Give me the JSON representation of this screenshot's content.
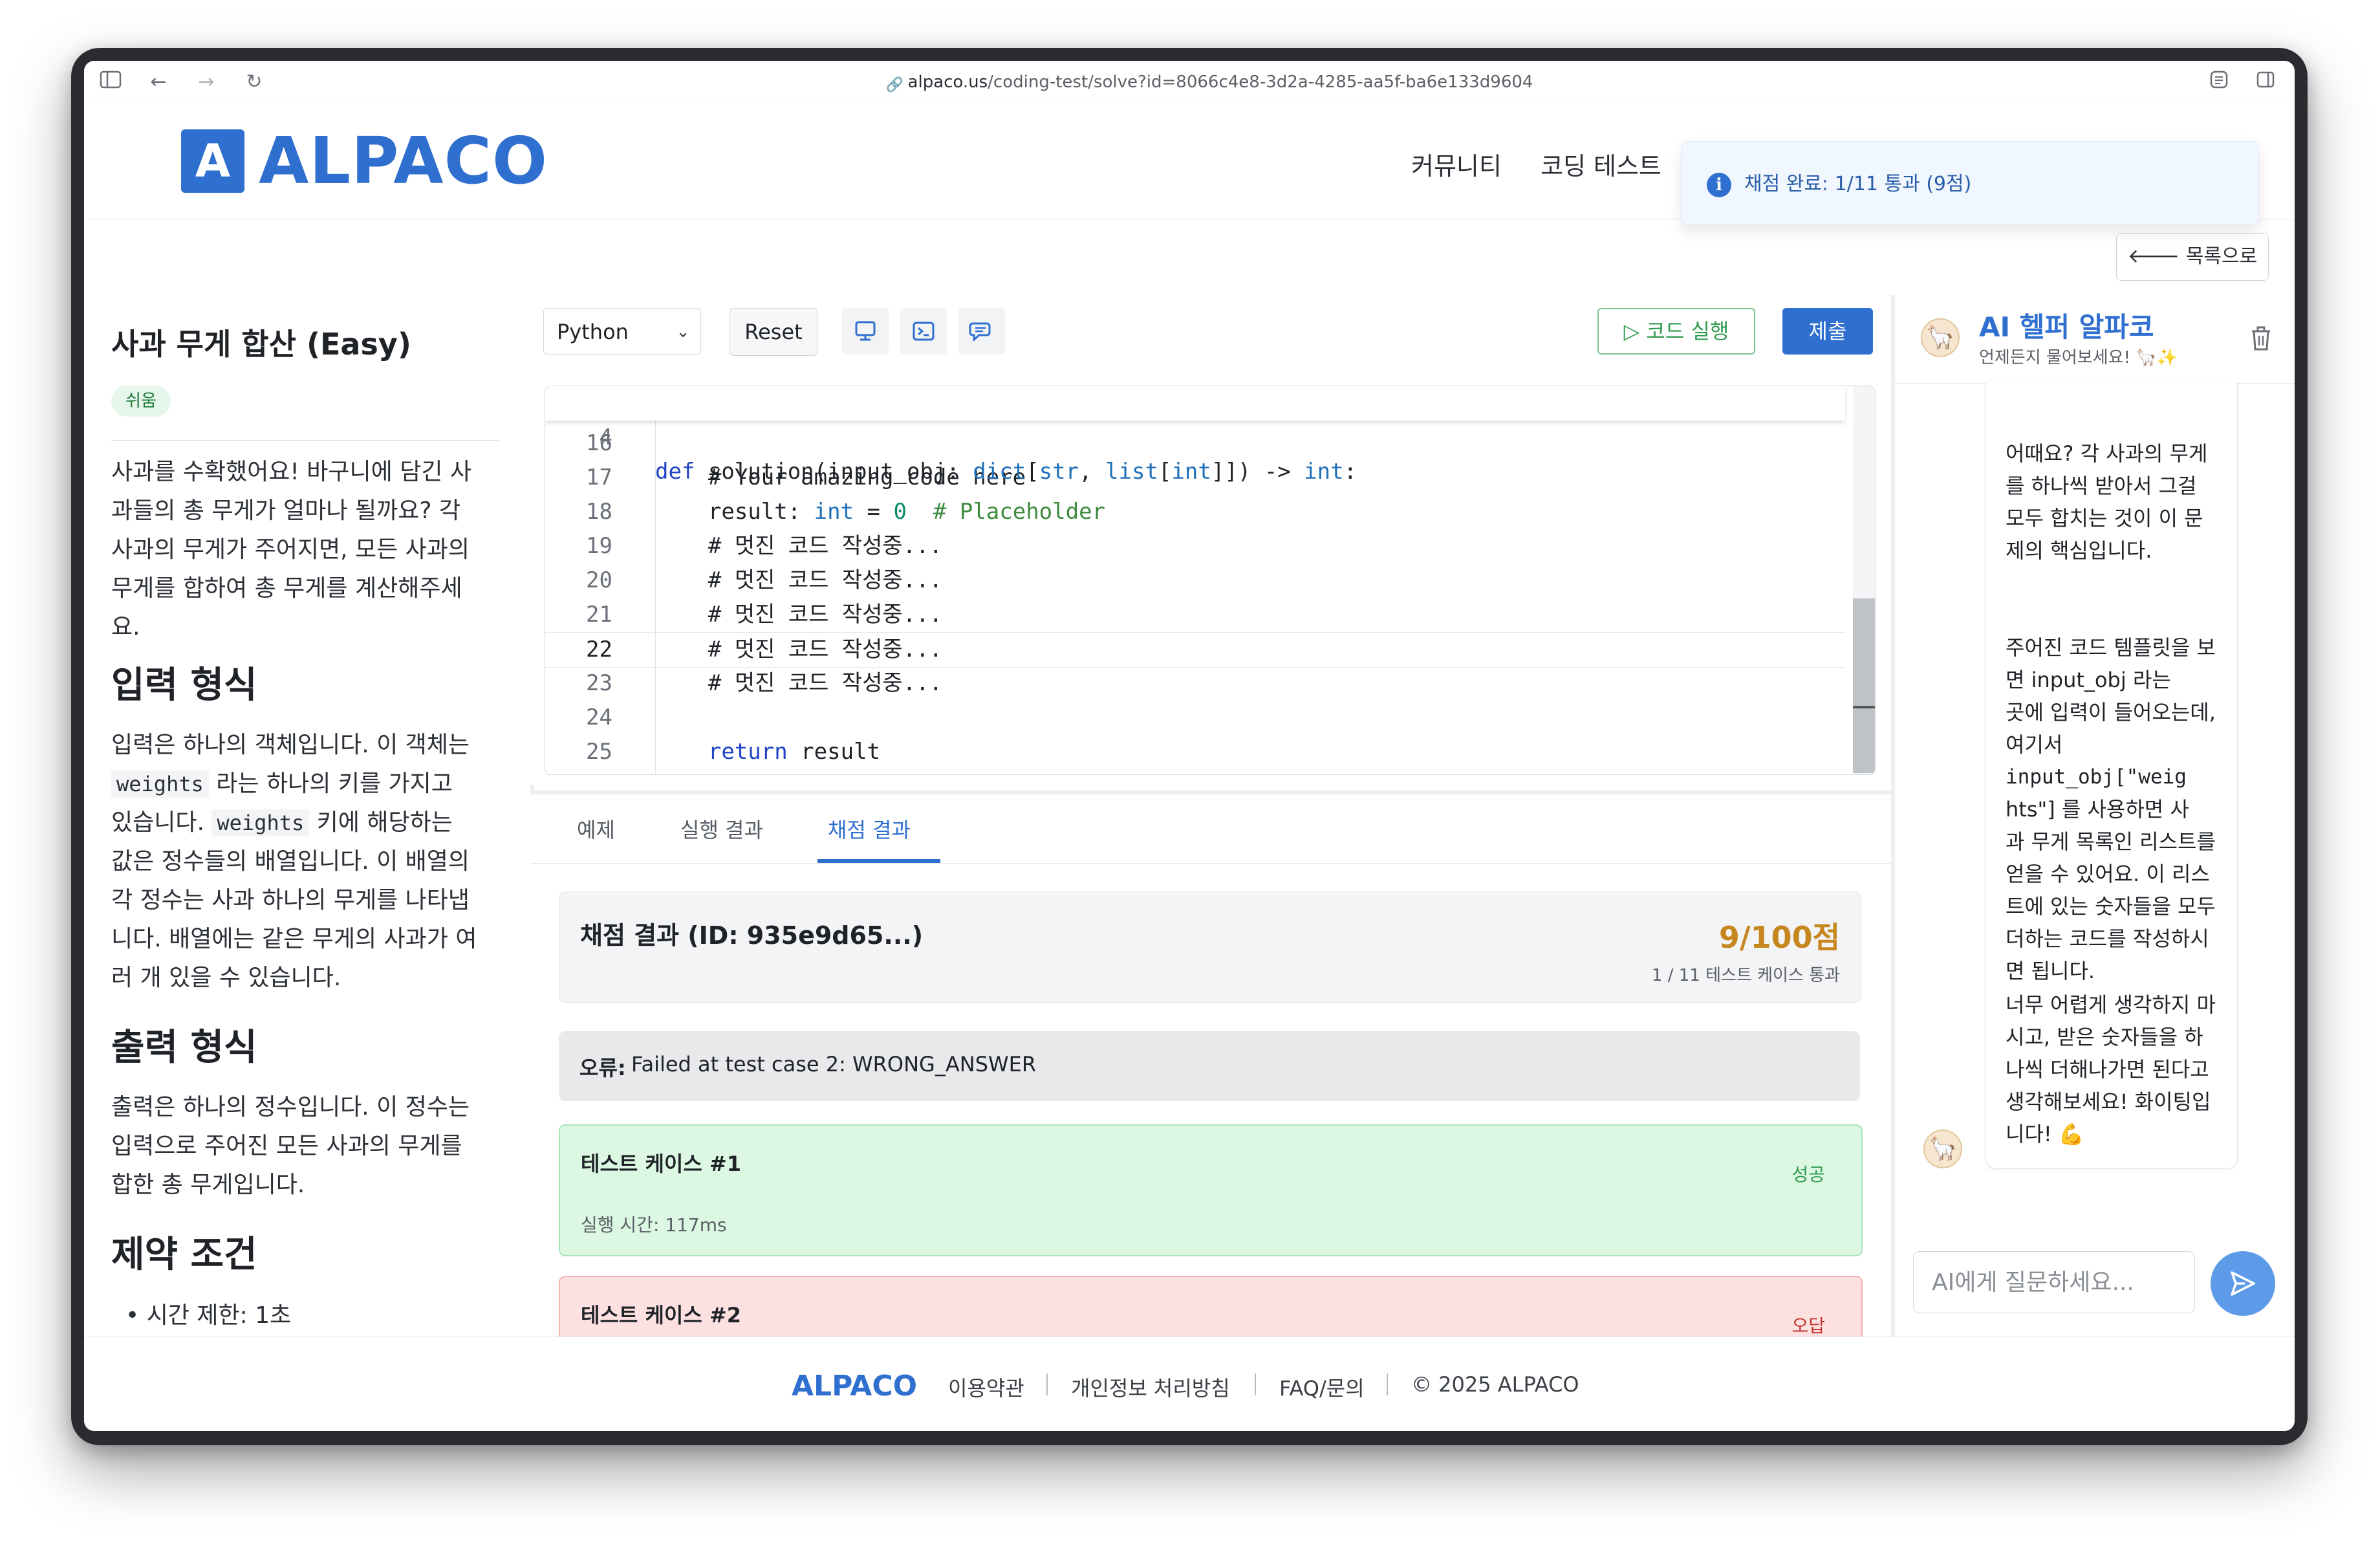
{
  "browser": {
    "url_host": "alpaco.us",
    "url_path": "/coding-test/solve?id=8066c4e8-3d2a-4285-aa5f-ba6e133d9604"
  },
  "header": {
    "logo_letter": "A",
    "logo_text": "ALPACO",
    "nav": [
      "커뮤니티",
      "코딩 테스트"
    ]
  },
  "toast": {
    "message": "채점 완료: 1/11 통과 (9점)",
    "icon": "info-icon"
  },
  "subbar": {
    "back_label": "목록으로"
  },
  "problem": {
    "title": "사과 무게 합산 (Easy)",
    "difficulty": "쉬움",
    "description_lines": [
      "사과를 수확했어요! 바구니에 담긴 사",
      "과들의 총 무게가 얼마나 될까요? 각",
      "사과의 무게가 주어지면, 모든 사과의",
      "무게를 합하여 총 무게를 계산해주세",
      "요."
    ],
    "input_heading": "입력 형식",
    "input_lines": [
      {
        "a": "입력은 하나의 객체입니다. 이 객체는",
        "code": "",
        "b": ""
      },
      {
        "a": "",
        "code": "weights",
        "b": " 라는 하나의 키를 가지고"
      },
      {
        "a": "있습니다. ",
        "code": "weights",
        "b": " 키에 해당하는"
      },
      {
        "a": "값은 정수들의 배열입니다. 이 배열의",
        "code": "",
        "b": ""
      },
      {
        "a": "각 정수는 사과 하나의 무게를 나타냅",
        "code": "",
        "b": ""
      },
      {
        "a": "니다. 배열에는 같은 무게의 사과가 여",
        "code": "",
        "b": ""
      },
      {
        "a": "러 개 있을 수 있습니다.",
        "code": "",
        "b": ""
      }
    ],
    "output_heading": "출력 형식",
    "output_lines": [
      "출력은 하나의 정수입니다. 이 정수는",
      "입력으로 주어진 모든 사과의 무게를",
      "합한 총 무게입니다."
    ],
    "constraints_heading": "제약 조건",
    "constraints": [
      "시간 제한: 1초"
    ]
  },
  "editor": {
    "language": "Python",
    "reset_label": "Reset",
    "icon_buttons": [
      "monitor-icon",
      "terminal-icon",
      "chat-icon"
    ],
    "run_label": "코드 실행",
    "submit_label": "제출",
    "sticky_line": {
      "num": "4",
      "text": "def solution(input_obj: dict[str, list[int]]) -> int:"
    },
    "lines": [
      {
        "num": "16",
        "text": ""
      },
      {
        "num": "17",
        "text": "    # Your amazing code here"
      },
      {
        "num": "18",
        "text": "    result: int = 0  # Placeholder"
      },
      {
        "num": "19",
        "text": "    # 멋진 코드 작성중..."
      },
      {
        "num": "20",
        "text": "    # 멋진 코드 작성중..."
      },
      {
        "num": "21",
        "text": "    # 멋진 코드 작성중..."
      },
      {
        "num": "22",
        "text": "    # 멋진 코드 작성중..."
      },
      {
        "num": "23",
        "text": "    # 멋진 코드 작성중..."
      },
      {
        "num": "24",
        "text": ""
      },
      {
        "num": "25",
        "text": "    return result"
      }
    ],
    "current_line": "22"
  },
  "results": {
    "tabs": [
      "예제",
      "실행 결과",
      "채점 결과"
    ],
    "active_tab": "채점 결과",
    "summary_title": "채점 결과 (ID: 935e9d65...)",
    "score": "9/100점",
    "passed_text": "1 / 11 테스트 케이스 통과",
    "error_label": "오류:",
    "error_text": "Failed at test case 2: WRONG_ANSWER",
    "cases": [
      {
        "title": "테스트 케이스 #1",
        "status": "성공",
        "time": "실행 시간: 117ms",
        "result": "pass"
      },
      {
        "title": "테스트 케이스 #2",
        "status": "오답",
        "time": "",
        "result": "fail"
      }
    ]
  },
  "ai": {
    "title": "AI 헬퍼 알파코",
    "subtitle": "언제든지 물어보세요! 🦙✨",
    "messages": [
      [
        "어때요? 각 사과의 무게",
        "를 하나씩 받아서 그걸",
        "모두 합치는 것이 이 문",
        "제의 핵심입니다."
      ],
      [
        "주어진 코드 템플릿을 보",
        "면 input_obj 라는",
        "곳에 입력이 들어오는데,",
        "여기서",
        "input_obj[\"weig",
        "hts\"] 를 사용하면 사",
        "과 무게 목록인 리스트를",
        "얻을 수 있어요. 이 리스",
        "트에 있는 숫자들을 모두",
        "더하는 코드를 작성하시",
        "면 됩니다."
      ],
      [
        "너무 어렵게 생각하지 마",
        "시고, 받은 숫자들을 하",
        "나씩 더해나가면 된다고",
        "생각해보세요! 화이팅입",
        "니다! 💪"
      ]
    ],
    "input_placeholder": "AI에게 질문하세요..."
  },
  "footer": {
    "logo": "ALPACO",
    "links": [
      "이용약관",
      "개인정보 처리방침",
      "FAQ/문의",
      "© 2025 ALPACO"
    ]
  }
}
